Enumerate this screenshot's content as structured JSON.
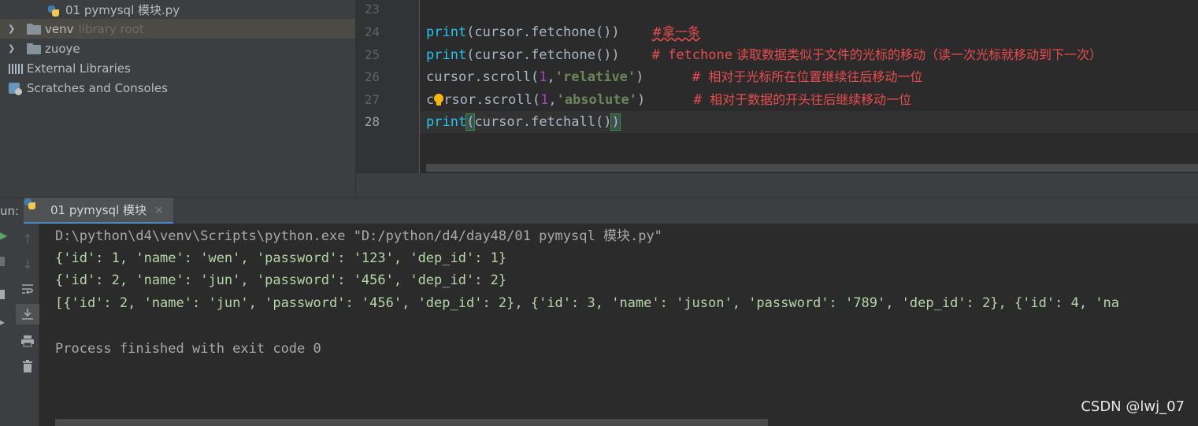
{
  "project_tree": {
    "items": [
      {
        "label": "01 pymysql 模块.py",
        "icon": "python-file-icon"
      },
      {
        "label": "venv",
        "sublabel": "library root",
        "icon": "folder-icon",
        "expandable": true,
        "selected": true
      },
      {
        "label": "zuoye",
        "icon": "folder-icon",
        "expandable": true
      },
      {
        "label": "External Libraries",
        "icon": "libraries-icon"
      },
      {
        "label": "Scratches and Consoles",
        "icon": "scratches-icon"
      }
    ]
  },
  "editor": {
    "line_numbers": [
      "23",
      "24",
      "25",
      "26",
      "27",
      "28"
    ],
    "lines": {
      "l24": {
        "fn": "print",
        "args": "(cursor.fetchone())",
        "comment": "#拿一条"
      },
      "l25": {
        "fn": "print",
        "args": "(cursor.fetchone())",
        "comment_hash": "# fetchone",
        "comment_cn": " 读取数据类似于文件的光标的移动（读一次光标就移动到下一次）"
      },
      "l26": {
        "code": "cursor.scroll(",
        "num": "1",
        "comma": ",",
        "str": "'relative'",
        "close": ")",
        "comment_hash": "# ",
        "comment_cn": "相对于光标所在位置继续往后移动一位"
      },
      "l27": {
        "code_a": "c",
        "code_b": "rsor.scroll(",
        "num": "1",
        "comma": ",",
        "str": "'absolute'",
        "close": ")",
        "comment_hash": "# ",
        "comment_cn": "相对于数据的开头往后继续移动一位"
      },
      "l28": {
        "fn": "print",
        "open": "(",
        "args": "cursor.fetchall()",
        "close": ")"
      }
    }
  },
  "run_panel": {
    "label": "un:",
    "tab_label": "01 pymysql 模块",
    "close_symbol": "×",
    "console": [
      "D:\\python\\d4\\venv\\Scripts\\python.exe \"D:/python/d4/day48/01 pymysql 模块.py\"",
      "{'id': 1, 'name': 'wen', 'password': '123', 'dep_id': 1}",
      "{'id': 2, 'name': 'jun', 'password': '456', 'dep_id': 2}",
      "[{'id': 2, 'name': 'jun', 'password': '456', 'dep_id': 2}, {'id': 3, 'name': 'juson', 'password': '789', 'dep_id': 2}, {'id': 4, 'na",
      "",
      "Process finished with exit code 0"
    ],
    "toolbar_icons": [
      "rerun-icon",
      "stop-icon",
      "pin-icon",
      "up-arrow-icon",
      "down-arrow-icon",
      "soft-wrap-icon",
      "scroll-to-end-icon",
      "print-icon",
      "trash-icon"
    ]
  },
  "watermark": "CSDN @lwj_07",
  "colors": {
    "background": "#2b2b2b",
    "panel": "#3c3f41",
    "print_keyword": "#20c5f2",
    "comment": "#e84c4c",
    "string": "#6a8759",
    "console_output": "#b5d6a6"
  }
}
